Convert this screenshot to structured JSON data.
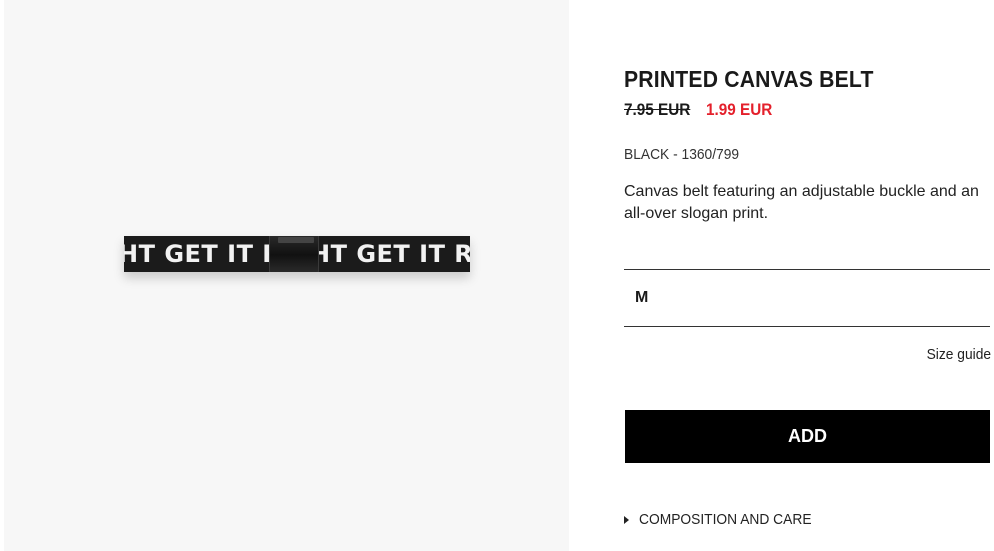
{
  "product": {
    "image_alt": "Printed canvas belt",
    "belt_print_left": "HT GET IT R",
    "belt_print_right": "HT GET IT R",
    "title": "PRINTED CANVAS BELT",
    "old_price": "7.95 EUR",
    "new_price": "1.99 EUR",
    "color_ref": "BLACK - 1360/799",
    "description": "Canvas belt featuring an adjustable buckle and an all-over slogan print.",
    "selected_size": "M",
    "size_guide_label": "Size guide",
    "add_label": "ADD",
    "composition_label": "COMPOSITION AND CARE"
  },
  "colors": {
    "sale_price": "#e4202b",
    "button_bg": "#000000",
    "image_bg": "#f7f7f7"
  }
}
